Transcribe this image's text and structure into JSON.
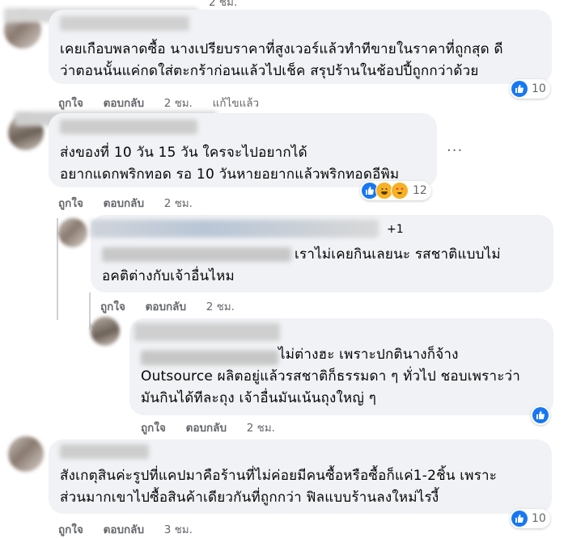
{
  "comments": [
    {
      "lines": [
        "เคยเกือบพลาดซื้อ นางเปรียบราคาที่สูงเวอร์แล้วทำทีขายในราคาที่ถูกสุด ดี",
        "ว่าตอนนั้นแค่กดใส่ตะกร้าก่อนแล้วไปเช็ค สรุปร้านในช้อปปี้ถูกกว่าด้วย"
      ],
      "like": "ถูกใจ",
      "reply": "ตอบกลับ",
      "time": "2 ชม.",
      "edited": "แก้ไขแล้ว",
      "reaction_count": "10"
    },
    {
      "lines": [
        "ส่งของที่ 10 วัน 15 วัน ใครจะไปอยากได้",
        "อยากแดกพริกทอด รอ 10 วันหายอยากแล้วพริกทอดอีพิม"
      ],
      "like": "ถูกใจ",
      "reply": "ตอบกลับ",
      "time": "2 ชม.",
      "reaction_count": "12"
    },
    {
      "plus": "+1",
      "lines": [
        "เราไม่เคยกินเลยนะ รสชาติแบบไม่",
        "อคติต่างกับเจ้าอื่นไหม"
      ],
      "like": "ถูกใจ",
      "reply": "ตอบกลับ",
      "time": "2 ชม."
    },
    {
      "lines": [
        "ไม่ต่างฮะ เพราะปกตินางก็จ้าง",
        "Outsource ผลิตอยู่แล้วรสชาติก็ธรรมดา ๆ ทั่วไป ชอบเพราะว่า",
        "มันกินได้ทีละถุง เจ้าอื่นมันเน้นถุงใหญ่ ๆ"
      ],
      "like": "ถูกใจ",
      "reply": "ตอบกลับ",
      "time": "2 ชม."
    },
    {
      "lines": [
        "สังเกตุสินค่ะรูปที่แคปมาคือร้านที่ไม่ค่อยมีคนซื้อหรือซื้อก็แค่1-2ชิ้น เพราะ",
        "ส่วนมากเขาไปซื้อสินค้าเดียวกันที่ถูกกว่า ฟิลแบบร้านลงใหม่ไรงี้"
      ],
      "like": "ถูกใจ",
      "reply": "ตอบกลับ",
      "time": "3 ชม.",
      "reaction_count": "10"
    }
  ],
  "top_partial_time": "2 ชม.",
  "more_options_glyph": "···",
  "colors": {
    "bubble": "#f0f2f5",
    "like_blue": "#1877f2",
    "meta_gray": "#65676b"
  }
}
